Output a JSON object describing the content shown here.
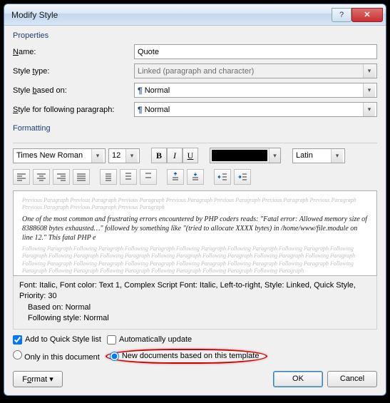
{
  "title": "Modify Style",
  "properties": {
    "heading": "Properties",
    "name_label": "Name:",
    "name_value": "Quote",
    "type_label": "Style type:",
    "type_value": "Linked (paragraph and character)",
    "based_label": "Style based on:",
    "based_value": "Normal",
    "following_label": "Style for following paragraph:",
    "following_value": "Normal"
  },
  "formatting": {
    "heading": "Formatting",
    "font": "Times New Roman",
    "size": "12",
    "script": "Latin"
  },
  "preview": {
    "grey_before": "Previous Paragraph Previous Paragraph Previous Paragraph Previous Paragraph Previous Paragraph Previous Paragraph Previous Paragraph Previous Paragraph Previous Paragraph Previous Paragraph",
    "sample": "One of the most common and frustrating errors encountered by PHP coders reads: \"Fatal error: Allowed memory size of 8388608 bytes exhausted…\" followed by something like \"(tried to allocate XXXX bytes) in /home/www/file.module on line 12.\" This fatal PHP e",
    "grey_after": "Following Paragraph Following Paragraph Following Paragraph Following Paragraph Following Paragraph Following Paragraph Following Paragraph Following Paragraph Following Paragraph Following Paragraph Following Paragraph Following Paragraph Following Paragraph Following Paragraph Following Paragraph Following Paragraph Following Paragraph Following Paragraph Following Paragraph Following Paragraph Following Paragraph Following Paragraph Following Paragraph Following Paragraph Following Paragraph"
  },
  "description": {
    "line1": "Font: Italic, Font color: Text 1, Complex Script Font: Italic, Left-to-right, Style: Linked, Quick Style, Priority: 30",
    "line2": "Based on: Normal",
    "line3": "Following style: Normal"
  },
  "options": {
    "quickstyle": "Add to Quick Style list",
    "autoupdate": "Automatically update",
    "only_doc": "Only in this document",
    "new_docs": "New documents based on this template"
  },
  "buttons": {
    "format": "Format",
    "ok": "OK",
    "cancel": "Cancel"
  }
}
